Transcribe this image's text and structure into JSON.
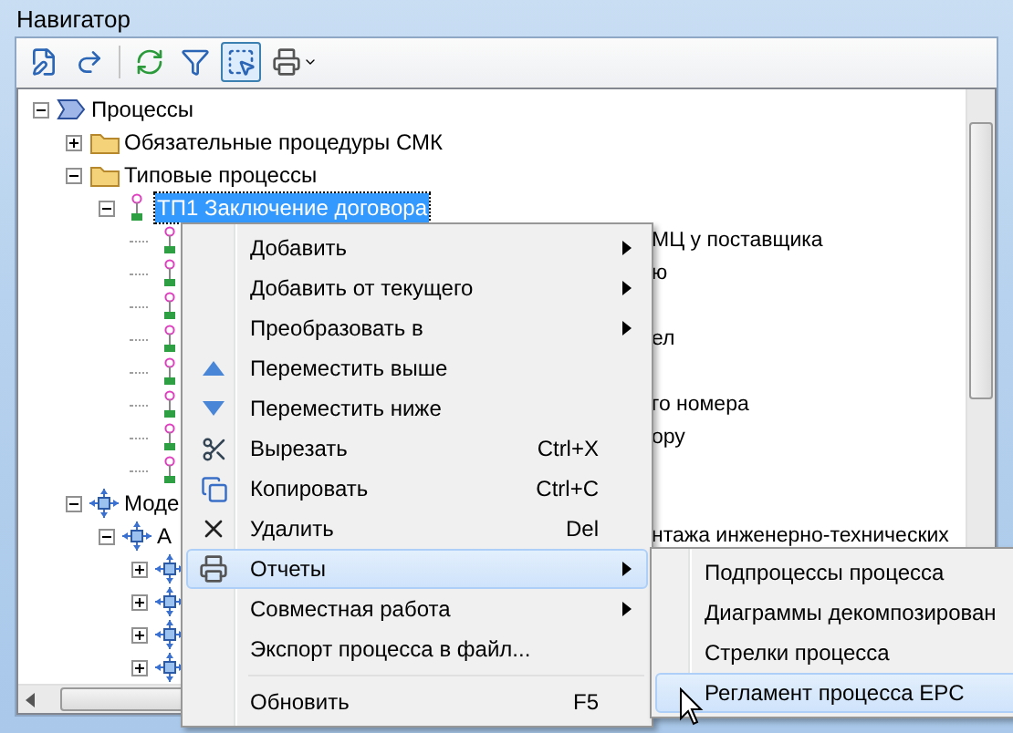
{
  "window": {
    "title": "Навигатор"
  },
  "toolbar": [
    {
      "kind": "edit",
      "selected": false
    },
    {
      "kind": "redo",
      "selected": false
    },
    {
      "kind": "separator"
    },
    {
      "kind": "refresh",
      "selected": false
    },
    {
      "kind": "filter",
      "selected": false
    },
    {
      "kind": "select",
      "selected": true
    },
    {
      "kind": "print",
      "selected": false
    }
  ],
  "tree": [
    {
      "label": "Процессы",
      "kind": "process",
      "expanded": true,
      "selected": false,
      "children": [
        {
          "label": "Обязательные процедуры СМК",
          "kind": "folder",
          "expanded": false,
          "selected": false
        },
        {
          "label": "Типовые процессы",
          "kind": "folder",
          "expanded": true,
          "selected": false,
          "children": [
            {
              "label": "ТП1 Заключение договора",
              "kind": "step",
              "expanded": true,
              "selected": true,
              "children": [
                {
                  "tail": "МЦ у поставщика",
                  "kind": "step",
                  "selected": false
                },
                {
                  "tail": "ю",
                  "kind": "step",
                  "selected": false
                },
                {
                  "kind": "step",
                  "selected": false
                },
                {
                  "tail": "ел",
                  "kind": "step",
                  "selected": false
                },
                {
                  "kind": "step",
                  "selected": false
                },
                {
                  "tail": "го номера",
                  "kind": "step",
                  "selected": false
                },
                {
                  "tail": "ору",
                  "kind": "step",
                  "selected": false
                },
                {
                  "kind": "step",
                  "selected": false
                }
              ]
            }
          ]
        },
        {
          "label": "Моде",
          "kind": "model",
          "expanded": true,
          "selected": false,
          "children": [
            {
              "label": "А",
              "tail": "нтажа инженерно-технических",
              "kind": "model",
              "expanded": true,
              "selected": false,
              "children": [
                {
                  "kind": "model",
                  "expanded": false,
                  "selected": false
                },
                {
                  "kind": "model",
                  "expanded": false,
                  "selected": false
                },
                {
                  "kind": "model",
                  "expanded": false,
                  "selected": false
                },
                {
                  "kind": "model",
                  "expanded": false,
                  "selected": false
                }
              ]
            }
          ]
        }
      ]
    }
  ],
  "context_menu": [
    {
      "kind": "plain",
      "label": "Добавить",
      "submenu": true,
      "selected": false
    },
    {
      "kind": "plain",
      "label": "Добавить от текущего",
      "submenu": true,
      "selected": false
    },
    {
      "kind": "plain",
      "label": "Преобразовать в",
      "submenu": true,
      "selected": false
    },
    {
      "kind": "up",
      "label": "Переместить выше",
      "selected": false
    },
    {
      "kind": "down",
      "label": "Переместить ниже",
      "selected": false
    },
    {
      "kind": "cut",
      "label": "Вырезать",
      "shortcut": "Ctrl+X",
      "selected": false
    },
    {
      "kind": "copy",
      "label": "Копировать",
      "shortcut": "Ctrl+C",
      "selected": false
    },
    {
      "kind": "delete",
      "label": "Удалить",
      "shortcut": "Del",
      "selected": false
    },
    {
      "kind": "report",
      "label": "Отчеты",
      "submenu": true,
      "selected": true
    },
    {
      "kind": "plain",
      "label": "Совместная работа",
      "submenu": true,
      "selected": false
    },
    {
      "kind": "plain",
      "label": "Экспорт процесса в файл...",
      "selected": false
    },
    {
      "kind": "separator"
    },
    {
      "kind": "plain",
      "label": "Обновить",
      "shortcut": "F5",
      "selected": false
    }
  ],
  "submenu": [
    {
      "label": "Подпроцессы процесса",
      "selected": false
    },
    {
      "label": "Диаграммы декомпозирован",
      "selected": false
    },
    {
      "label": "Стрелки процесса",
      "selected": false
    },
    {
      "label": "Регламент процесса EPC",
      "selected": true
    }
  ]
}
